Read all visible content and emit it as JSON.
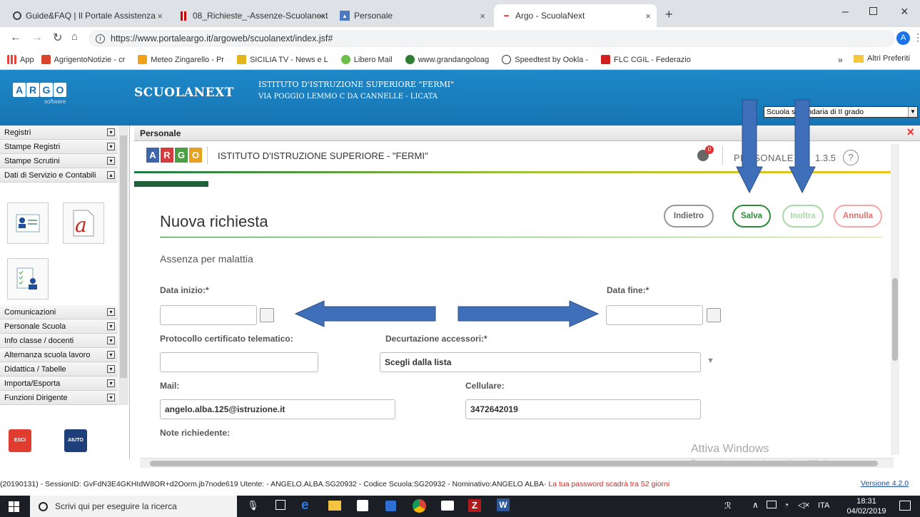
{
  "browser": {
    "tabs": [
      {
        "label": "Guide&FAQ | Il Portale Assistenza",
        "close": "×"
      },
      {
        "label": "08_Richieste_-Assenze-Scuolanext",
        "close": "×"
      },
      {
        "label": "Personale",
        "close": "×"
      },
      {
        "label": "Argo - ScuolaNext",
        "close": "×"
      }
    ],
    "new_tab": "+",
    "url": "https://www.portaleargo.it/argoweb/scuolanext/index.jsf#",
    "bookmarks": [
      "App",
      "AgrigentoNotizie - cr",
      "Meteo Zingarello - Pr",
      "SICILIA TV - News e L",
      "Libero Mail",
      "www.grandangoloag",
      "Speedtest by Ookla -",
      "FLC CGIL - Federazio"
    ],
    "bookmarks_more": "»",
    "other_bookmarks": "Altri Preferiti",
    "profile_initial": "A"
  },
  "header": {
    "logo_letters": [
      "A",
      "R",
      "G",
      "O"
    ],
    "logo_sub": "software",
    "app_name": "SCUOLANEXT",
    "school_line1": "ISTITUTO D'ISTRUZIONE SUPERIORE \"FERMI\"",
    "school_line2": "VIA POGGIO LEMMO C DA CANNELLE - LICATA",
    "school_select": "Scuola secondaria di II grado"
  },
  "sidebar": {
    "top_items": [
      "Registri",
      "Stampe Registri",
      "Stampe Scrutini",
      "Dati di Servizio e Contabili"
    ],
    "bottom_items": [
      "Comunicazioni",
      "Personale Scuola",
      "Info classe / docenti",
      "Alternanza scuola lavoro",
      "Didattica / Tabelle",
      "Importa/Esporta",
      "Funzioni Dirigente"
    ],
    "exit_label": "ESCI",
    "help_label": "AIUTO"
  },
  "panel": {
    "title": "Personale",
    "inst_name": "ISTITUTO D'ISTRUZIONE SUPERIORE - \"FERMI\"",
    "notif_count": "0",
    "module": "PERSONALE",
    "version": "1.3.5",
    "help": "?",
    "form_title": "Nuova richiesta",
    "buttons": {
      "back": "Indietro",
      "save": "Salva",
      "send": "Inoltra",
      "cancel": "Annulla"
    },
    "request_type": "Assenza per malattia",
    "start_label": "Data inizio:*",
    "end_label": "Data fine:*",
    "start_value": "",
    "end_value": "",
    "protocol_label": "Protocollo certificato telematico:",
    "protocol_value": "",
    "deduction_label": "Decurtazione accessori:*",
    "deduction_value": "Scegli dalla lista",
    "mail_label": "Mail:",
    "mail_value": "angelo.alba.125@istruzione.it",
    "phone_label": "Cellulare:",
    "phone_value": "3472642019",
    "notes_label": "Note richiedente:"
  },
  "watermark": {
    "line1": "Attiva Windows",
    "line2": "Passa a Impostazioni per attivare Windows."
  },
  "status": {
    "session": "(20190131) - SessionID: GvFdN3E4GKHIdW8OR+d2Oorm.jb7node619 Utente: - ANGELO.ALBA.SG20932 - Codice Scuola:SG20932 - Nominativo:ANGELO ALBA",
    "warning": " - La tua password scadrà tra 52 giorni",
    "version": "Versione 4.2.0"
  },
  "taskbar": {
    "search": "Scrivi qui per eseguire la ricerca",
    "lang": "ITA",
    "time": "18:31",
    "date": "04/02/2019"
  },
  "colors": {
    "argo_blue": "#1675b4",
    "save_green": "#2e8b3a",
    "cancel_red": "#e07070",
    "arrow_blue": "#3f6fb8"
  }
}
